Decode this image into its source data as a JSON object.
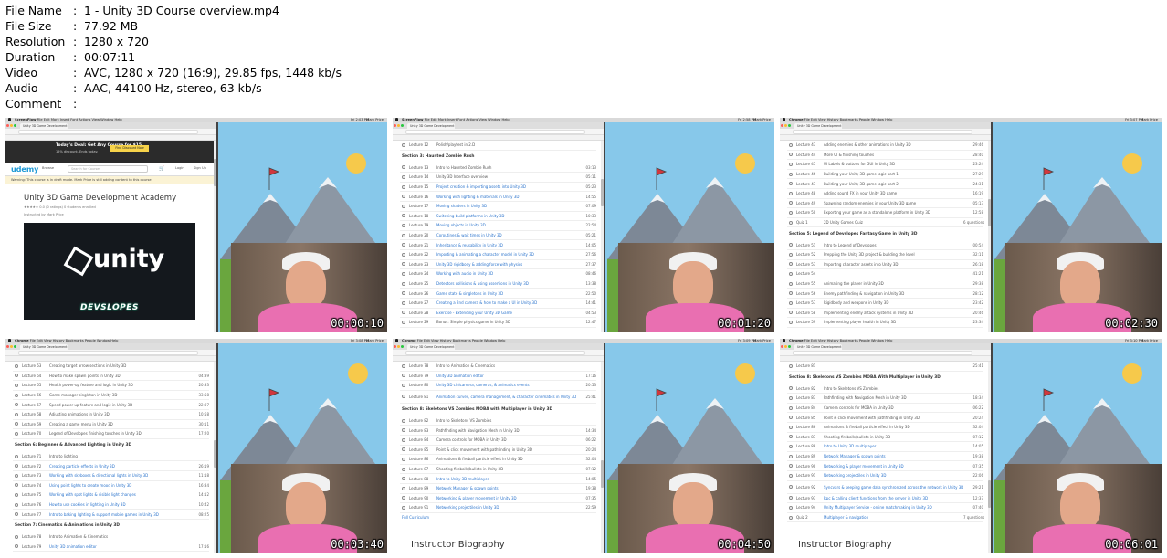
{
  "file_info": [
    {
      "key": "File Name",
      "value": "1 - Unity 3D Course overview.mp4"
    },
    {
      "key": "File Size",
      "value": "77.92 MB"
    },
    {
      "key": "Resolution",
      "value": "1280 x 720"
    },
    {
      "key": "Duration",
      "value": "00:07:11"
    },
    {
      "key": "Video",
      "value": "AVC, 1280 x 720 (16:9), 29.85 fps, 1448 kb/s"
    },
    {
      "key": "Audio",
      "value": "AAC, 44100 Hz, stereo, 63 kb/s"
    },
    {
      "key": "Comment",
      "value": ""
    }
  ],
  "separator": ":",
  "colors": {
    "sky": "#87c8ea",
    "sun": "#f6c94b",
    "shirt": "#e96fb1",
    "link": "#2a73cc"
  },
  "thumbnails": [
    {
      "timestamp": "00:00:10",
      "app": "ScreenFlow",
      "menu": "File  Edit  Mark  Insert  Font  Actions  View  Window  Help",
      "clock": "Fri 2:03 PM",
      "user": "Mark Price",
      "tab_title": "Unity 3D Game Development",
      "page": "udemy",
      "udemy": {
        "deal_title": "Today's Deal: Get Any Course for $15",
        "deal_sub": "15% discount. Ends today.",
        "deal_button": "Find Discount Now",
        "logo": "udemy",
        "browse": "Browse",
        "search_placeholder": "Search for Courses",
        "login": "Login",
        "signup": "Sign Up",
        "warning": "Warning: This course is in draft mode. Mark Price is still adding content to this course.",
        "course_title": "Unity 3D Game Development Academy",
        "rating": "★★★★★ 0.0 (0 ratings)   0 students enrolled",
        "instructor": "Instructed by Mark Price",
        "video_brand": "unity",
        "video_caption": "DEVSLOPES"
      }
    },
    {
      "timestamp": "00:01:20",
      "app": "ScreenFlow",
      "menu": "File  Edit  Mark  Insert  Font  Actions  View  Window  Help",
      "clock": "Fri 2:58 PM",
      "user": "Mark Price",
      "tab_title": "Unity 3D Game Development",
      "page": "list",
      "items": [
        {
          "kind": "lecture",
          "num": "Lecture 12",
          "title": "Polish/playtest in 2.D",
          "dur": ""
        },
        {
          "kind": "section",
          "title": "Section 3: Haunted Zombie Rush"
        },
        {
          "kind": "lecture",
          "num": "Lecture 13",
          "title": "Intro to Haunted Zombie Rush",
          "dur": "03:13"
        },
        {
          "kind": "lecture",
          "num": "Lecture 14",
          "title": "Unity 3D Interface overview",
          "dur": "05:11"
        },
        {
          "kind": "lecture",
          "num": "Lecture 15",
          "title": "Project creation & importing assets into Unity 3D",
          "dur": "05:23",
          "link": true
        },
        {
          "kind": "lecture",
          "num": "Lecture 16",
          "title": "Working with lighting & materials in Unity 3D",
          "dur": "14:55",
          "link": true
        },
        {
          "kind": "lecture",
          "num": "Lecture 17",
          "title": "Moving shaders in Unity 3D",
          "dur": "07:09",
          "link": true
        },
        {
          "kind": "lecture",
          "num": "Lecture 18",
          "title": "Switching build platforms in Unity 3D",
          "dur": "10:33",
          "link": true
        },
        {
          "kind": "lecture",
          "num": "Lecture 19",
          "title": "Moving objects in Unity 3D",
          "dur": "22:54",
          "link": true
        },
        {
          "kind": "lecture",
          "num": "Lecture 20",
          "title": "Coroutines & wait times in Unity 3D",
          "dur": "05:21",
          "link": true
        },
        {
          "kind": "lecture",
          "num": "Lecture 21",
          "title": "Inheritance & reusability in Unity 3D",
          "dur": "14:05",
          "link": true
        },
        {
          "kind": "lecture",
          "num": "Lecture 22",
          "title": "Importing & animating a character model in Unity 3D",
          "dur": "27:56",
          "link": true
        },
        {
          "kind": "lecture",
          "num": "Lecture 23",
          "title": "Unity 3D rigidbody & adding force with physics",
          "dur": "27:37",
          "link": true
        },
        {
          "kind": "lecture",
          "num": "Lecture 24",
          "title": "Working with audio in Unity 3D",
          "dur": "08:46",
          "link": true
        },
        {
          "kind": "lecture",
          "num": "Lecture 25",
          "title": "Detectors collisions & using assertions in Unity 3D",
          "dur": "13:38",
          "link": true
        },
        {
          "kind": "lecture",
          "num": "Lecture 26",
          "title": "Game state & singletons in Unity 3D",
          "dur": "22:50",
          "link": true
        },
        {
          "kind": "lecture",
          "num": "Lecture 27",
          "title": "Creating a 2nd camera & how to make a UI in Unity 3D",
          "dur": "14:41",
          "link": true
        },
        {
          "kind": "lecture",
          "num": "Lecture 28",
          "title": "Exercise - Extending your Unity 3D Game",
          "dur": "04:53",
          "link": true
        },
        {
          "kind": "lecture",
          "num": "Lecture 29",
          "title": "Bonus: Simple physics game in Unity 3D",
          "dur": "12:47"
        }
      ]
    },
    {
      "timestamp": "00:02:30",
      "app": "Chrome",
      "menu": "File  Edit  View  History  Bookmarks  People  Window  Help",
      "clock": "Fri 3:07 PM",
      "user": "Mark Price",
      "tab_title": "Unity 3D Game Development",
      "page": "list",
      "items": [
        {
          "kind": "lecture",
          "num": "Lecture 43",
          "title": "Adding enemies & other animations in Unity 3D",
          "dur": "29:46"
        },
        {
          "kind": "lecture",
          "num": "Lecture 44",
          "title": "More UI & finishing touches",
          "dur": "28:40"
        },
        {
          "kind": "lecture",
          "num": "Lecture 45",
          "title": "UI Labels & buttons for GUI in Unity 3D",
          "dur": "23:24"
        },
        {
          "kind": "lecture",
          "num": "Lecture 46",
          "title": "Building your Unity 3D game logic part 1",
          "dur": "27:29"
        },
        {
          "kind": "lecture",
          "num": "Lecture 47",
          "title": "Building your Unity 3D game logic part 2",
          "dur": "24:31"
        },
        {
          "kind": "lecture",
          "num": "Lecture 48",
          "title": "Adding sound FX in your Unity 3D game",
          "dur": "16:19"
        },
        {
          "kind": "lecture",
          "num": "Lecture 49",
          "title": "Spawning random enemies in your Unity 3D game",
          "dur": "05:13"
        },
        {
          "kind": "lecture",
          "num": "Lecture 50",
          "title": "Exporting your game as a standalone platform in Unity 3D",
          "dur": "12:58"
        },
        {
          "kind": "lecture",
          "num": "Quiz 1",
          "title": "2D Unity Games Quiz",
          "dur": "6 questions"
        },
        {
          "kind": "section",
          "title": "Section 5: Legend of Devslopes Fantasy Game in Unity 3D"
        },
        {
          "kind": "lecture",
          "num": "Lecture 51",
          "title": "Intro to Legend of Devslopes",
          "dur": "00:54"
        },
        {
          "kind": "lecture",
          "num": "Lecture 52",
          "title": "Prepping the Unity 3D project & building the level",
          "dur": "32:11"
        },
        {
          "kind": "lecture",
          "num": "Lecture 53",
          "title": "Importing character assets into Unity 3D",
          "dur": "26:18"
        },
        {
          "kind": "lecture",
          "num": "Lecture 54",
          "title": "",
          "dur": "41:21"
        },
        {
          "kind": "lecture",
          "num": "Lecture 55",
          "title": "Animating the player in Unity 3D",
          "dur": "29:38"
        },
        {
          "kind": "lecture",
          "num": "Lecture 56",
          "title": "Enemy pathfinding & navigation in Unity 3D",
          "dur": "28:12"
        },
        {
          "kind": "lecture",
          "num": "Lecture 57",
          "title": "Rigidbody and weapons in Unity 3D",
          "dur": "23:42"
        },
        {
          "kind": "lecture",
          "num": "Lecture 58",
          "title": "Implementing enemy attack systems in Unity 3D",
          "dur": "20:46"
        },
        {
          "kind": "lecture",
          "num": "Lecture 59",
          "title": "Implementing player health in Unity 3D",
          "dur": "23:34"
        }
      ]
    },
    {
      "timestamp": "00:03:40",
      "app": "Chrome",
      "menu": "File  Edit  View  History  Bookmarks  People  Window  Help",
      "clock": "Fri 3:08 PM",
      "user": "Mark Price",
      "tab_title": "Unity 3D Game Development",
      "page": "list",
      "items": [
        {
          "kind": "lecture",
          "num": "Lecture 63",
          "title": "Creating target arrow sections in Unity 3D",
          "dur": ""
        },
        {
          "kind": "lecture",
          "num": "Lecture 64",
          "title": "How to make spawn points in Unity 3D",
          "dur": "04:39"
        },
        {
          "kind": "lecture",
          "num": "Lecture 65",
          "title": "Health power-up feature and logic in Unity 3D",
          "dur": "20:33"
        },
        {
          "kind": "lecture",
          "num": "Lecture 66",
          "title": "Game manager singleton in Unity 3D",
          "dur": "33:58"
        },
        {
          "kind": "lecture",
          "num": "Lecture 67",
          "title": "Speed power-up feature and logic in Unity 3D",
          "dur": "22:07"
        },
        {
          "kind": "lecture",
          "num": "Lecture 68",
          "title": "Adjusting animations in Unity 3D",
          "dur": "10:58"
        },
        {
          "kind": "lecture",
          "num": "Lecture 69",
          "title": "Creating a game menu in Unity 3D",
          "dur": "30:11"
        },
        {
          "kind": "lecture",
          "num": "Lecture 70",
          "title": "Legend of Devslopes finishing touches in Unity 3D",
          "dur": "17:20"
        },
        {
          "kind": "section",
          "title": "Section 6: Beginner & Advanced Lighting in Unity 3D"
        },
        {
          "kind": "lecture",
          "num": "Lecture 71",
          "title": "Intro to lighting",
          "dur": ""
        },
        {
          "kind": "lecture",
          "num": "Lecture 72",
          "title": "Creating particle effects in Unity 3D",
          "dur": "26:19",
          "link": true
        },
        {
          "kind": "lecture",
          "num": "Lecture 73",
          "title": "Working with skyboxes & directional lights in Unity 3D",
          "dur": "11:18",
          "link": true
        },
        {
          "kind": "lecture",
          "num": "Lecture 74",
          "title": "Using point lights to create mood in Unity 3D",
          "dur": "16:34",
          "link": true
        },
        {
          "kind": "lecture",
          "num": "Lecture 75",
          "title": "Working with spot lights & visible light changes",
          "dur": "14:12",
          "link": true
        },
        {
          "kind": "lecture",
          "num": "Lecture 76",
          "title": "How to use cookies in lighting in Unity 3D",
          "dur": "10:42",
          "link": true
        },
        {
          "kind": "lecture",
          "num": "Lecture 77",
          "title": "Intro to baking lighting & support mobile games in Unity 3D",
          "dur": "08:25",
          "link": true
        },
        {
          "kind": "section",
          "title": "Section 7: Cinematics & Animations in Unity 3D"
        },
        {
          "kind": "lecture",
          "num": "Lecture 78",
          "title": "Intro to Animation & Cinematics",
          "dur": ""
        },
        {
          "kind": "lecture",
          "num": "Lecture 79",
          "title": "Unity 3D animation editor",
          "dur": "17:16",
          "link": true
        }
      ]
    },
    {
      "timestamp": "00:04:50",
      "app": "Chrome",
      "menu": "File  Edit  View  History  Bookmarks  People  Window  Help",
      "clock": "Fri 3:09 PM",
      "user": "Mark Price",
      "tab_title": "Unity 3D Game Development",
      "page": "list",
      "items": [
        {
          "kind": "lecture",
          "num": "Lecture 78",
          "title": "Intro to Animation & Cinematics",
          "dur": ""
        },
        {
          "kind": "lecture",
          "num": "Lecture 79",
          "title": "Unity 3D animation editor",
          "dur": "17:16",
          "link": true
        },
        {
          "kind": "lecture",
          "num": "Lecture 80",
          "title": "Unity 3D cinicamera, cameras, & animatics events",
          "dur": "20:53",
          "link": true
        },
        {
          "kind": "lecture",
          "num": "Lecture 81",
          "title": "Animation curves, camera management, & character cinematics in Unity 3D",
          "dur": "25:41",
          "link": true,
          "tall": true
        },
        {
          "kind": "section",
          "title": "Section 8: Skeletons VS Zombies MOBA with Multiplayer in Unity 3D"
        },
        {
          "kind": "lecture",
          "num": "Lecture 82",
          "title": "Intro to Skeletons VS Zombies",
          "dur": ""
        },
        {
          "kind": "lecture",
          "num": "Lecture 83",
          "title": "Pathfinding with Navigation Mesh in Unity 3D",
          "dur": "14:34"
        },
        {
          "kind": "lecture",
          "num": "Lecture 84",
          "title": "Camera controls for MOBA in Unity 3D",
          "dur": "06:22"
        },
        {
          "kind": "lecture",
          "num": "Lecture 85",
          "title": "Point & click movement with pathfinding in Unity 3D",
          "dur": "20:24"
        },
        {
          "kind": "lecture",
          "num": "Lecture 86",
          "title": "Animations & fireball particle effect in Unity 3D",
          "dur": "32:04"
        },
        {
          "kind": "lecture",
          "num": "Lecture 87",
          "title": "Shooting fireballs/bullets in Unity 3D",
          "dur": "07:12"
        },
        {
          "kind": "lecture",
          "num": "Lecture 88",
          "title": "Intro to Unity 3D multiplayer",
          "dur": "14:05",
          "link": true
        },
        {
          "kind": "lecture",
          "num": "Lecture 89",
          "title": "Network Manager & spawn points",
          "dur": "19:38",
          "link": true
        },
        {
          "kind": "lecture",
          "num": "Lecture 90",
          "title": "Networking & player movement in Unity 3D",
          "dur": "07:35",
          "link": true
        },
        {
          "kind": "lecture",
          "num": "Lecture 91",
          "title": "Networking projectiles in Unity 3D",
          "dur": "22:59",
          "link": true
        },
        {
          "kind": "link",
          "title": "Full Curriculum"
        }
      ],
      "bio": "Instructor Biography"
    },
    {
      "timestamp": "00:06:01",
      "app": "Chrome",
      "menu": "File  Edit  View  History  Bookmarks  People  Window  Help",
      "clock": "Fri 3:10 PM",
      "user": "Mark Price",
      "tab_title": "Unity 3D Game Development",
      "page": "list",
      "items": [
        {
          "kind": "lecture",
          "num": "Lecture 81",
          "title": "",
          "dur": "25:41"
        },
        {
          "kind": "section",
          "title": "Section 8: Skeletons VS Zombies MOBA With Multiplayer in Unity 3D"
        },
        {
          "kind": "lecture",
          "num": "Lecture 82",
          "title": "Intro to Skeletons VS Zombies",
          "dur": ""
        },
        {
          "kind": "lecture",
          "num": "Lecture 83",
          "title": "Pathfinding with Navigation Mesh in Unity 3D",
          "dur": "18:34"
        },
        {
          "kind": "lecture",
          "num": "Lecture 84",
          "title": "Camera controls for MOBA in Unity 3D",
          "dur": "06:22"
        },
        {
          "kind": "lecture",
          "num": "Lecture 85",
          "title": "Point & click movement with pathfinding in Unity 3D",
          "dur": "20:24"
        },
        {
          "kind": "lecture",
          "num": "Lecture 86",
          "title": "Animations & fireball particle effect in Unity 3D",
          "dur": "32:04"
        },
        {
          "kind": "lecture",
          "num": "Lecture 87",
          "title": "Shooting fireballs/bullets in Unity 3D",
          "dur": "07:12"
        },
        {
          "kind": "lecture",
          "num": "Lecture 88",
          "title": "Intro to Unity 3D multiplayer",
          "dur": "14:05",
          "link": true
        },
        {
          "kind": "lecture",
          "num": "Lecture 89",
          "title": "Network Manager & spawn points",
          "dur": "19:38",
          "link": true
        },
        {
          "kind": "lecture",
          "num": "Lecture 90",
          "title": "Networking & player movement in Unity 3D",
          "dur": "07:35",
          "link": true
        },
        {
          "kind": "lecture",
          "num": "Lecture 91",
          "title": "Networking projectiles in Unity 3D",
          "dur": "22:06",
          "link": true
        },
        {
          "kind": "lecture",
          "num": "Lecture 92",
          "title": "Syncvars & keeping game data synchronized across the network in Unity 3D",
          "dur": "29:21",
          "link": true,
          "tall": true
        },
        {
          "kind": "lecture",
          "num": "Lecture 93",
          "title": "Rpc & calling client functions from the server in Unity 3D",
          "dur": "12:37",
          "link": true
        },
        {
          "kind": "lecture",
          "num": "Lecture 94",
          "title": "Unity Multiplayer Service - online matchmaking in Unity 3D",
          "dur": "07:40",
          "link": true
        },
        {
          "kind": "lecture",
          "num": "Quiz 2",
          "title": "Multiplayer & navigation",
          "dur": "7 questions",
          "link": true
        }
      ],
      "bio": "Instructor Biography"
    }
  ]
}
